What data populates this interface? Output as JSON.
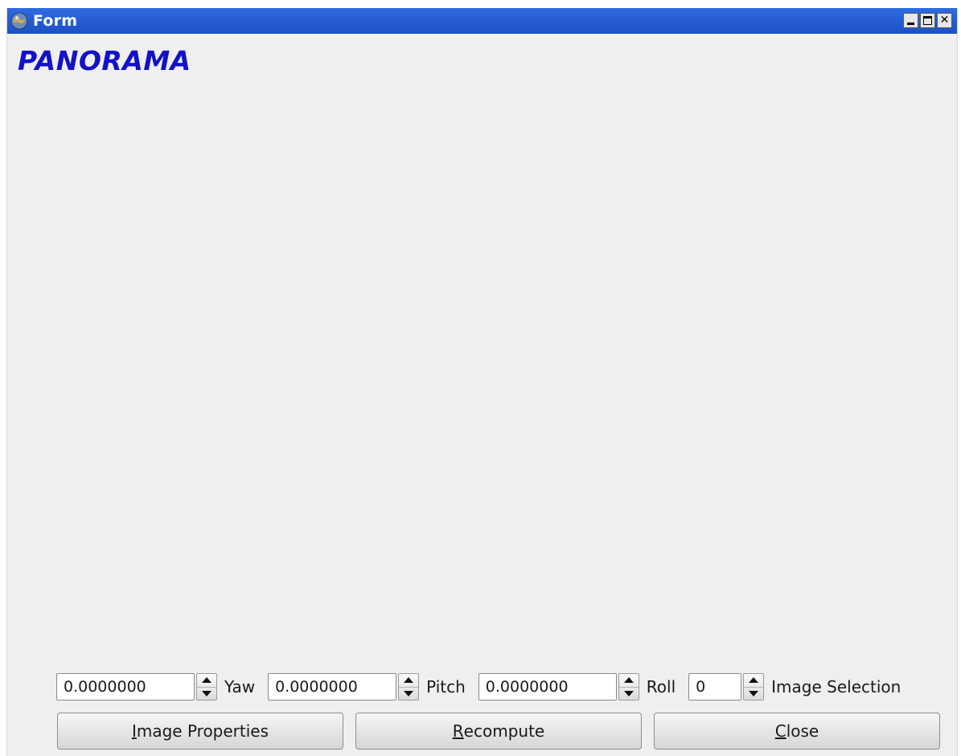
{
  "window": {
    "title": "Form",
    "controls": {
      "minimize_icon": "minimize-icon",
      "maximize_icon": "maximize-icon",
      "close_icon": "close-icon",
      "close_glyph": "✕"
    }
  },
  "heading": "PANORAMA",
  "colors": {
    "titlebar": "#2059d6",
    "heading": "#1212c8",
    "background": "#efefef"
  },
  "controls": {
    "yaw": {
      "value": "0.0000000",
      "label": "Yaw"
    },
    "pitch": {
      "value": "0.0000000",
      "label": "Pitch"
    },
    "roll": {
      "value": "0.0000000",
      "label": "Roll"
    },
    "image_selection": {
      "value": "0",
      "label": "Image Selection"
    }
  },
  "buttons": {
    "image_properties": {
      "mnemonic": "I",
      "rest": "mage Properties"
    },
    "recompute": {
      "mnemonic": "R",
      "rest": "ecompute"
    },
    "close": {
      "mnemonic": "C",
      "rest": "lose"
    }
  }
}
